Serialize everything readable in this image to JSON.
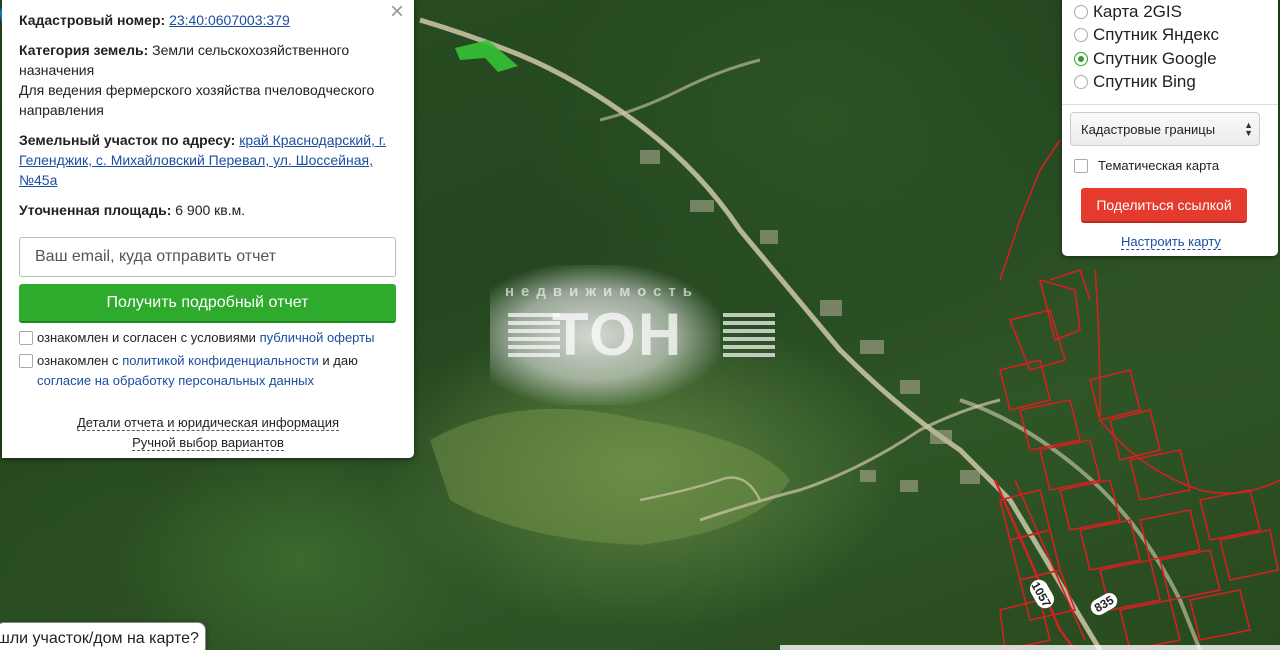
{
  "info": {
    "cadastral_label": "Кадастровый номер:",
    "cadastral_value": "23:40:0607003:379",
    "category_label": "Категория земель:",
    "category_value": "Земли сельскохозяйственного назначения",
    "usage": "Для ведения фермерского хозяйства пчеловодческого направления",
    "address_label": "Земельный участок по адресу:",
    "address_value": "край Краснодарский, г. Геленджик, с. Михайловский Перевал, ул. Шоссейная, №45а",
    "area_label": "Уточненная площадь:",
    "area_value": "6 900 кв.м.",
    "close_icon": "×",
    "email_placeholder": "Ваш email, куда отправить отчет",
    "report_button": "Получить подробный отчет",
    "consent1_text": "ознакомлен и согласен с условиями",
    "consent1_link": "публичной оферты",
    "consent2_text_a": "ознакомлен с",
    "consent2_link_a": "политикой конфиденциальности",
    "consent2_text_b": "и даю",
    "consent2_link_b": "согласие на обработку персональных данных",
    "details_link": "Детали отчета и юридическая информация",
    "manual_link": "Ручной выбор вариантов"
  },
  "map_options": {
    "layers": [
      {
        "label": "Карта 2GIS",
        "selected": false
      },
      {
        "label": "Спутник Яндекс",
        "selected": false
      },
      {
        "label": "Спутник Google",
        "selected": true
      },
      {
        "label": "Спутник Bing",
        "selected": false
      }
    ],
    "overlay_select": "Кадастровые границы",
    "thematic_label": "Тематическая карта",
    "share_button": "Поделиться ссылкой",
    "configure_link": "Настроить карту"
  },
  "map": {
    "watermark_top": "недвижимость",
    "watermark_word": "ТОН",
    "road_label_1": "1057",
    "road_label_2": "835",
    "accent_green": "#2eaa2c",
    "accent_red": "#e53a2e",
    "pin_color": "#1e8fe6"
  },
  "popup": {
    "found_text": "шли участок/дом на карте?"
  }
}
